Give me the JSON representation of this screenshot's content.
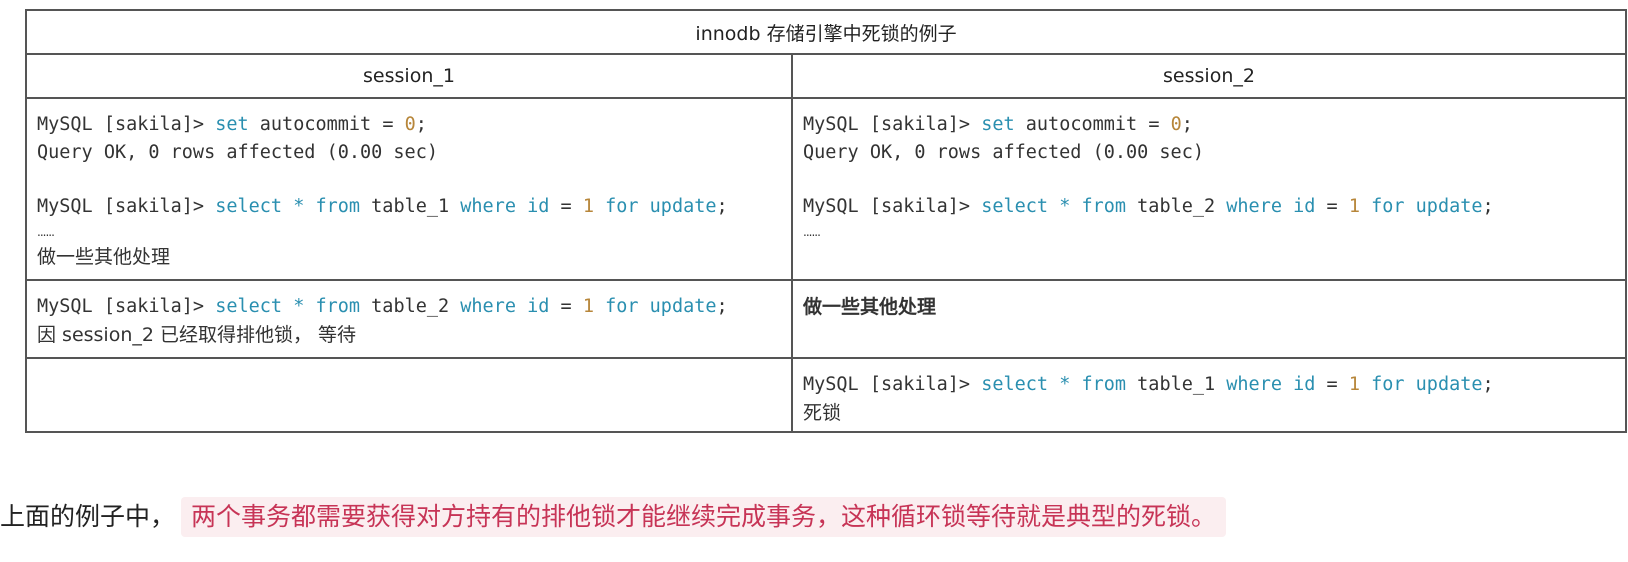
{
  "table": {
    "caption": "innodb 存储引擎中死锁的例子",
    "headers": [
      "session_1",
      "session_2"
    ],
    "prompt": "MySQL [sakila]> ",
    "r1": {
      "s1": {
        "stmt_set": "set autocommit = 0;",
        "result": "Query OK, 0 rows affected (0.00 sec)",
        "stmt_select": "select * from table_1 where id = 1 for update;",
        "dots": "......",
        "note": "做一些其他处理"
      },
      "s2": {
        "stmt_set": "set autocommit = 0;",
        "result": "Query OK, 0 rows affected (0.00 sec)",
        "stmt_select": "select * from table_2 where id = 1 for update;",
        "dots": "......"
      }
    },
    "r2": {
      "s1": {
        "stmt_select": "select * from table_2 where id = 1 for update;",
        "note": "因 session_2 已经取得排他锁， 等待"
      },
      "s2": {
        "note": "做一些其他处理"
      }
    },
    "r3": {
      "s2": {
        "stmt_select": "select * from table_1 where id = 1 for update;",
        "note": "死锁"
      }
    }
  },
  "footer": {
    "intro": "上面的例子中，",
    "highlight": "两个事务都需要获得对方持有的排他锁才能继续完成事务，这种循环锁等待就是典型的死锁。"
  },
  "colors": {
    "keyword": "#2a8fb0",
    "number": "#b7863a",
    "highlight_text": "#c73456",
    "highlight_bg": "#fbeef0"
  }
}
